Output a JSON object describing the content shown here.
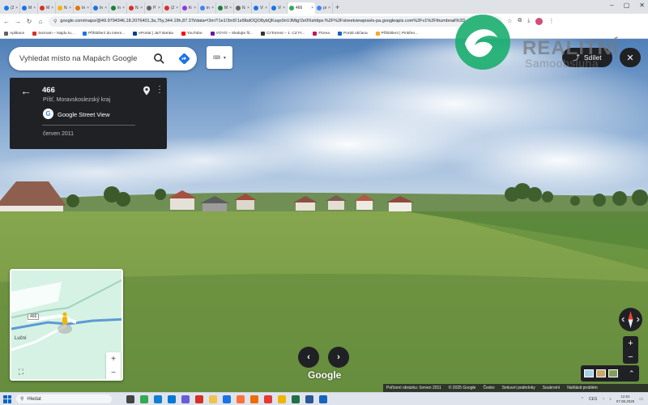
{
  "browser": {
    "tabs": [
      {
        "label": "(2)",
        "color": "#1877f2"
      },
      {
        "label": "My",
        "color": "#1a73e8"
      },
      {
        "label": "My",
        "color": "#d93025"
      },
      {
        "label": "Nal",
        "color": "#f4b400"
      },
      {
        "label": "Inz",
        "color": "#e8710a"
      },
      {
        "label": "Inz",
        "color": "#1a73e8"
      },
      {
        "label": "Inz",
        "color": "#188038"
      },
      {
        "label": "Nal",
        "color": "#d93025"
      },
      {
        "label": "PSČ",
        "color": "#5f6368"
      },
      {
        "label": "(2)",
        "color": "#d93025"
      },
      {
        "label": "Kon",
        "color": "#9334e6"
      },
      {
        "label": "inze",
        "color": "#4285f4"
      },
      {
        "label": "My",
        "color": "#188038"
      },
      {
        "label": "Nal",
        "color": "#5f6368"
      },
      {
        "label": "VDI",
        "color": "#1a73e8"
      },
      {
        "label": "VDI",
        "color": "#1a73e8"
      },
      {
        "label": "466",
        "color": "#34a853",
        "active": true
      },
      {
        "label": "pro",
        "color": "#4285f4"
      }
    ],
    "url": "google.com/maps/@49.9794346,18.2076401,3a,75y,344.19h,87.37t/data=!3m7!1e1!3m5!1sI9bdOQO8ybQKsqo0nVJMtg!2e0!6shttps:%2F%2Fstreetviewpixels-pa.googleapis.com%2Fv1%2Fthumbnail%3D",
    "bookmarks": [
      {
        "label": "Aplikace",
        "color": "#5f6368"
      },
      {
        "label": "Seznam – Najdu tu...",
        "color": "#d93025"
      },
      {
        "label": "Přihlášení do intern...",
        "color": "#1a73e8"
      },
      {
        "label": "ePortal | J&T Banka",
        "color": "#0b3d91"
      },
      {
        "label": "YouTube",
        "color": "#ff0000"
      },
      {
        "label": "VOYO – Sledujte fil...",
        "color": "#6a1b9a"
      },
      {
        "label": "CzTorrent – 1. CZ Fr...",
        "color": "#333333"
      },
      {
        "label": "Florea",
        "color": "#c2185b"
      },
      {
        "label": "Portál občana",
        "color": "#1565c0"
      },
      {
        "label": "Přihlášení | Pinkřen...",
        "color": "#f9a825"
      }
    ]
  },
  "maps": {
    "search_placeholder": "Vyhledat místo na Mapách Google",
    "place": {
      "title": "466",
      "subtitle": "Píšť, Moravskoslezský kraj",
      "provider": "Google Street View",
      "date": "červen 2011"
    },
    "share_label": "Sdílet",
    "minimap": {
      "road_label": "466",
      "street_label": "Luční"
    },
    "logo": "Google",
    "attribution": [
      "Pořízení obrázku: červen 2011",
      "© 2025 Google",
      "Česko",
      "Smluvní podmínky",
      "Soukromí",
      "Nahlásit problém"
    ]
  },
  "watermark": {
    "title": "REALITNÍ",
    "subtitle": "Samoobsluha",
    "color": "#1aae6f"
  },
  "taskbar": {
    "search_placeholder": "Hledat",
    "apps": [
      {
        "name": "task-view",
        "color": "#444444"
      },
      {
        "name": "chrome",
        "color": "#34a853"
      },
      {
        "name": "edge",
        "color": "#0f7fd6"
      },
      {
        "name": "mail",
        "color": "#0078d4"
      },
      {
        "name": "store",
        "color": "#6b5bd6"
      },
      {
        "name": "media",
        "color": "#d93025"
      },
      {
        "name": "file-explorer",
        "color": "#f2c14e"
      },
      {
        "name": "vpn",
        "color": "#1a73e8"
      },
      {
        "name": "firefox",
        "color": "#ff7139"
      },
      {
        "name": "app-orange",
        "color": "#ef6c00"
      },
      {
        "name": "app-red",
        "color": "#e53935"
      },
      {
        "name": "app-yellow",
        "color": "#f2b400"
      },
      {
        "name": "excel",
        "color": "#1e7145"
      },
      {
        "name": "word",
        "color": "#2b579a"
      },
      {
        "name": "photos",
        "color": "#1565c0"
      }
    ],
    "lang": "CES",
    "time": "12:51",
    "date": "07.08.2025"
  }
}
